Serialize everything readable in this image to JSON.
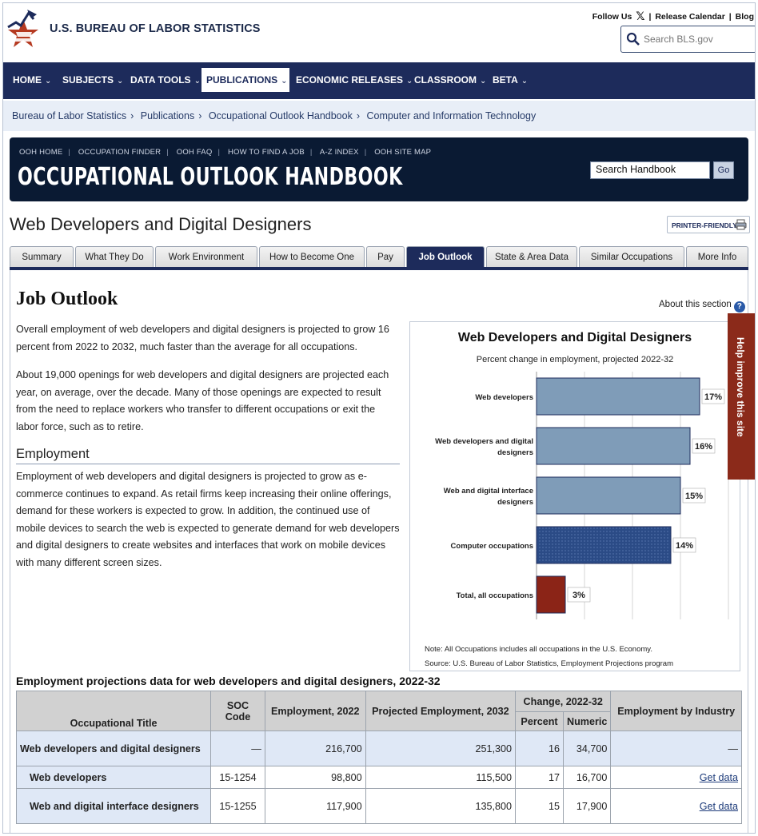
{
  "header": {
    "site_title": "U.S. BUREAU OF LABOR STATISTICS",
    "follow_us": "Follow Us",
    "release_calendar": "Release Calendar",
    "blog": "Blog",
    "search_placeholder": "Search BLS.gov"
  },
  "nav": {
    "items": [
      {
        "label": "HOME"
      },
      {
        "label": "SUBJECTS"
      },
      {
        "label": "DATA TOOLS"
      },
      {
        "label": "PUBLICATIONS"
      },
      {
        "label": "ECONOMIC RELEASES"
      },
      {
        "label": "CLASSROOM"
      },
      {
        "label": "BETA"
      }
    ]
  },
  "breadcrumb": [
    "Bureau of Labor Statistics",
    "Publications",
    "Occupational Outlook Handbook",
    "Computer and Information Technology"
  ],
  "ooh": {
    "links": [
      "OOH HOME",
      "OCCUPATION FINDER",
      "OOH FAQ",
      "HOW TO FIND A JOB",
      "A-Z INDEX",
      "OOH SITE MAP"
    ],
    "title": "OCCUPATIONAL OUTLOOK HANDBOOK",
    "search_value": "Search Handbook",
    "go": "Go"
  },
  "page": {
    "title": "Web Developers and Digital Designers",
    "printer_friendly": "PRINTER-FRIENDLY"
  },
  "tabs": [
    "Summary",
    "What They Do",
    "Work Environment",
    "How to Become One",
    "Pay",
    "Job Outlook",
    "State & Area Data",
    "Similar Occupations",
    "More Info"
  ],
  "section": {
    "heading": "Job Outlook",
    "about": "About this section",
    "p1": "Overall employment of web developers and digital designers is projected to grow 16 percent from 2022 to 2032, much faster than the average for all occupations.",
    "p2": "About 19,000 openings for web developers and digital designers are projected each year, on average, over the decade. Many of those openings are expected to result from the need to replace workers who transfer to different occupations or exit the labor force, such as to retire.",
    "employment_heading": "Employment",
    "p3": "Employment of web developers and digital designers is projected to grow as e-commerce continues to expand. As retail firms keep increasing their online offerings, demand for these workers is expected to grow. In addition, the continued use of mobile devices to search the web is expected to generate demand for web developers and digital designers to create websites and interfaces that work on mobile devices with many different screen sizes."
  },
  "feedback": "Help improve this site",
  "chart_data": {
    "type": "bar",
    "orientation": "horizontal",
    "title": "Web Developers and Digital Designers",
    "subtitle": "Percent change in employment, projected 2022-32",
    "categories": [
      [
        "Web developers"
      ],
      [
        "Web developers and digital",
        "designers"
      ],
      [
        "Web and digital interface",
        "designers"
      ],
      [
        "Computer occupations"
      ],
      [
        "Total, all occupations"
      ]
    ],
    "values": [
      17,
      16,
      15,
      14,
      3
    ],
    "value_labels": [
      "17%",
      "16%",
      "15%",
      "14%",
      "3%"
    ],
    "colors": [
      "#7f9cb8",
      "#7f9cb8",
      "#7f9cb8",
      "#2b4b86",
      "#8b2417"
    ],
    "xlim": [
      0,
      20
    ],
    "note": "Note: All Occupations includes all occupations in the U.S. Economy.",
    "source": "Source: U.S. Bureau of Labor Statistics, Employment Projections program"
  },
  "table": {
    "title": "Employment projections data for web developers and digital designers, 2022-32",
    "headers": {
      "title": "Occupational Title",
      "soc": "SOC Code",
      "emp": "Employment, 2022",
      "proj": "Projected Employment, 2032",
      "change": "Change, 2022-32",
      "percent": "Percent",
      "numeric": "Numeric",
      "industry": "Employment by Industry"
    },
    "rows": [
      {
        "title": "Web developers and digital designers",
        "soc": "—",
        "emp": "216,700",
        "proj": "251,300",
        "pct": "16",
        "num": "34,700",
        "ind": "—"
      },
      {
        "title": "Web developers",
        "soc": "15-1254",
        "emp": "98,800",
        "proj": "115,500",
        "pct": "17",
        "num": "16,700",
        "ind": "Get data"
      },
      {
        "title": "Web and digital interface designers",
        "soc": "15-1255",
        "emp": "117,900",
        "proj": "135,800",
        "pct": "15",
        "num": "17,900",
        "ind": "Get data"
      }
    ]
  }
}
